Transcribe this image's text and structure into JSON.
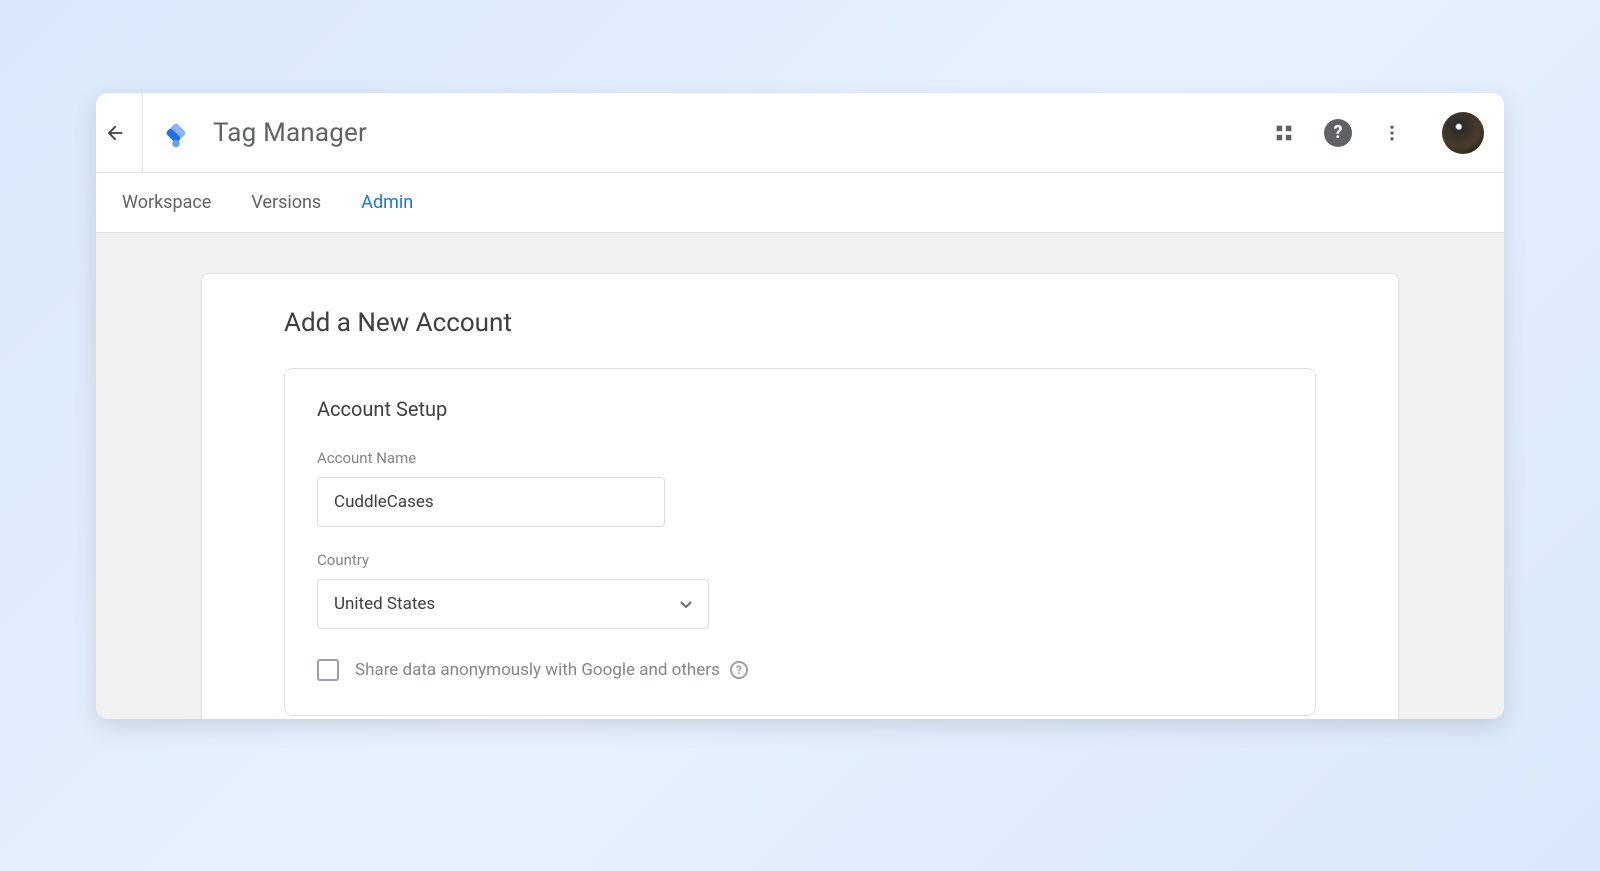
{
  "header": {
    "app_title": "Tag Manager"
  },
  "tabs": {
    "workspace": "Workspace",
    "versions": "Versions",
    "admin": "Admin",
    "active": "admin"
  },
  "page": {
    "title": "Add a New Account",
    "section_title": "Account Setup",
    "account_name_label": "Account Name",
    "account_name_value": "CuddleCases",
    "country_label": "Country",
    "country_value": "United States",
    "share_checkbox_label": "Share data anonymously with Google and others",
    "share_checked": false
  },
  "icons": {
    "back": "arrow-back",
    "apps": "grid-apps",
    "help": "help",
    "more": "more-vert",
    "info": "info"
  },
  "colors": {
    "accent": "#1a73e8",
    "text_secondary": "#5f6368"
  }
}
